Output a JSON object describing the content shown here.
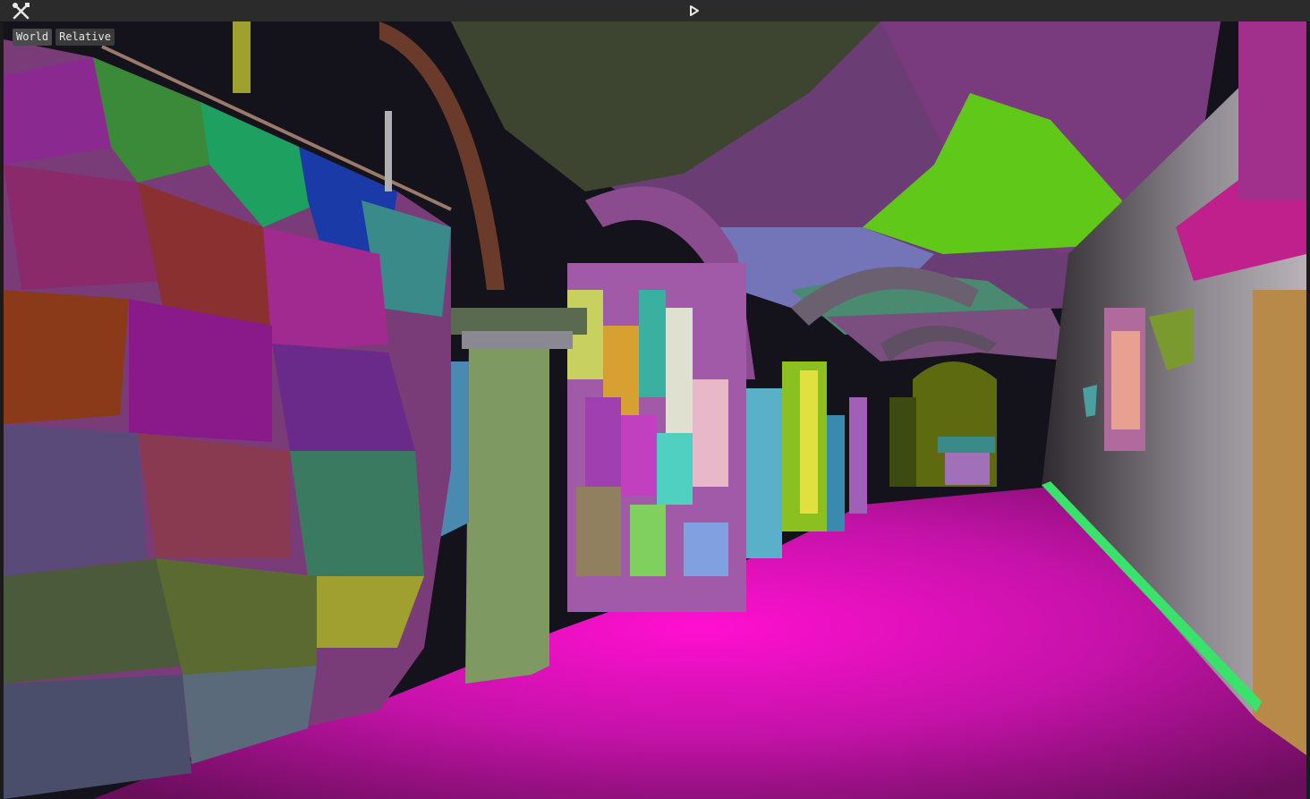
{
  "toolbar": {
    "tools_icon": "tools-icon",
    "play_icon": "play-icon"
  },
  "viewport": {
    "space_modes": [
      {
        "label": "World",
        "active": true
      },
      {
        "label": "Relative",
        "active": false
      }
    ]
  },
  "colors": {
    "floor": "#c010a8",
    "vault": "#6a3e74",
    "accent_green": "#5fc818",
    "baseboard": "#3ae26c"
  }
}
